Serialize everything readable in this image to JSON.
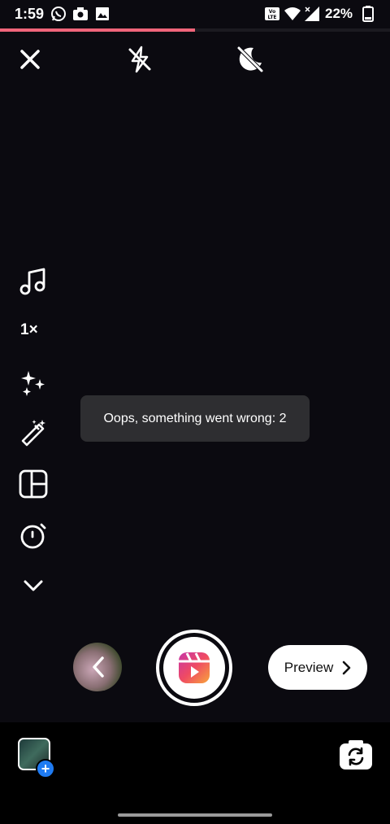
{
  "status_bar": {
    "time": "1:59",
    "battery_percent": "22%",
    "icons": [
      "whatsapp-icon",
      "camera-icon",
      "image-icon",
      "volte-icon",
      "wifi-icon",
      "signal-icon",
      "battery-icon"
    ]
  },
  "recording_progress": 0.5,
  "top_controls": [
    "close-icon",
    "flash-off-icon",
    "night-mode-off-icon"
  ],
  "side_tools": {
    "speed_label": "1×",
    "icons": [
      "music-icon",
      "effects-icon",
      "touch-up-icon",
      "layout-icon",
      "timer-icon",
      "chevron-down-icon"
    ]
  },
  "toast": {
    "message": "Oops, something went wrong: 2"
  },
  "capture": {
    "preview_label": "Preview"
  },
  "bottom_bar": {
    "icons": [
      "gallery-icon",
      "flip-camera-icon"
    ]
  },
  "colors": {
    "progress": "#f0657a",
    "accent_blue": "#1f7bf2",
    "toast_bg": "#2e2e31"
  }
}
